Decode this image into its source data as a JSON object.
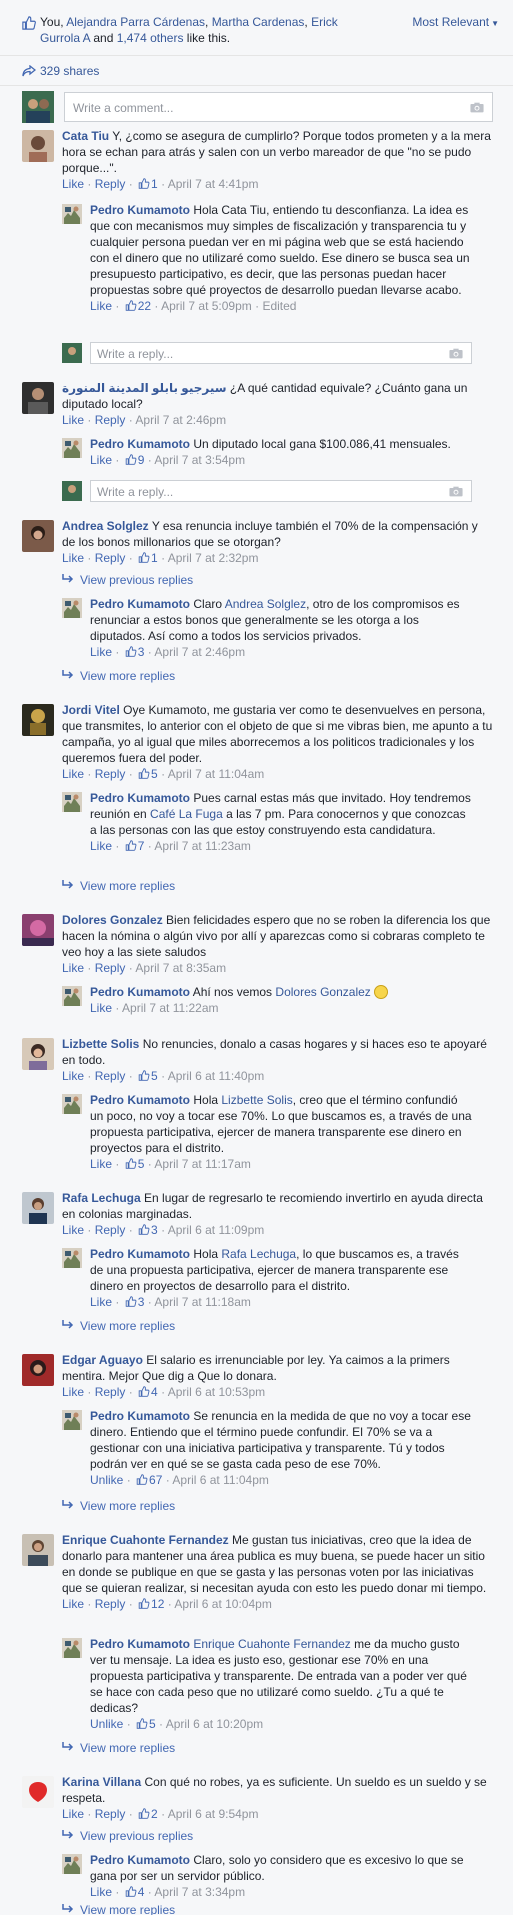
{
  "header": {
    "likes_prefix": "You, ",
    "liker1": "Alejandra Parra Cárdenas",
    "liker2": "Martha Cardenas",
    "liker3": "Erick Gurrola A",
    "and_text": " and ",
    "others": "1,474 others",
    "like_this": " like this.",
    "sort_label": "Most Relevant",
    "shares": "329 shares"
  },
  "composer": {
    "placeholder": "Write a comment..."
  },
  "reply_placeholder": "Write a reply...",
  "labels": {
    "like": "Like",
    "unlike": "Unlike",
    "reply": "Reply",
    "edited": "Edited",
    "view_previous": "View previous replies",
    "view_more": "View more replies"
  },
  "comments": [
    {
      "author": "Cata Tiu",
      "text": "Y, ¿como se asegura de cumplirlo? Porque todos prometen y a la mera hora se echan para atrás y salen con un verbo mareador de que \"no se pudo porque...\".",
      "likes": "1",
      "time": "April 7 at 4:41pm",
      "reply": {
        "author": "Pedro Kumamoto",
        "text": "Hola Cata Tiu, entiendo tu desconfianza. La idea es que con mecanismos muy simples de fiscalización y transparencia tu y cualquier persona puedan ver en mi página web que se está haciendo con el dinero que no utilizaré como sueldo. Ese dinero se busca sea un presupuesto participativo, es decir, que las personas puedan hacer propuestas sobre qué proyectos de desarrollo puedan llevarse acabo.",
        "likes": "22",
        "time": "April 7 at 5:09pm"
      }
    },
    {
      "author": "سيرجيو بابلو المدينة المنورة",
      "text": "¿A qué cantidad equivale? ¿Cuánto gana un diputado local?",
      "time": "April 7 at 2:46pm",
      "reply": {
        "author": "Pedro Kumamoto",
        "text": "Un diputado local gana $100.086,41 mensuales.",
        "likes": "9",
        "time": "April 7 at 3:54pm"
      }
    },
    {
      "author": "Andrea Solglez",
      "text": "Y esa renuncia incluye también el 70% de la compensación y de los bonos millonarios que se otorgan?",
      "likes": "1",
      "time": "April 7 at 2:32pm",
      "reply": {
        "author": "Pedro Kumamoto",
        "pre": "Claro ",
        "mention": "Andrea Solglez",
        "post": ", otro de los compromisos es renunciar a estos bonos que generalmente se les otorga a los diputados. Así como a todos los servicios privados.",
        "likes": "3",
        "time": "April 7 at 2:46pm"
      }
    },
    {
      "author": "Jordi Vitel",
      "text": "Oye Kumamoto, me gustaria ver como te desenvuelves en persona, que transmites, lo anterior con el objeto de que si me vibras bien, me apunto a tu campaña, yo al igual que miles aborrecemos a los politicos tradicionales y los queremos fuera del poder.",
      "likes": "5",
      "time": "April 7 at 11:04am",
      "reply": {
        "author": "Pedro Kumamoto",
        "pre": "Pues carnal estas más que invitado. Hoy tendremos reunión en ",
        "mention": "Café La Fuga",
        "post": " a las 7 pm. Para conocernos y que conozcas a las personas con las que estoy construyendo esta candidatura.",
        "likes": "7",
        "time": "April 7 at 11:23am"
      }
    },
    {
      "author": "Dolores Gonzalez",
      "text": "Bien felicidades espero que no se roben la diferencia los que hacen la nómina o algún vivo por allí y aparezcas como si cobraras completo te veo hoy a las siete saludos",
      "time": "April 7 at 8:35am",
      "reply": {
        "author": "Pedro Kumamoto",
        "pre": "Ahí nos vemos ",
        "mention": "Dolores Gonzalez",
        "time": "April 7 at 11:22am"
      }
    },
    {
      "author": "Lizbette Solis",
      "text": "No renuncies, donalo a casas hogares y si haces eso te apoyaré en todo.",
      "likes": "5",
      "time": "April 6 at 11:40pm",
      "reply": {
        "author": "Pedro Kumamoto",
        "pre": "Hola ",
        "mention": "Lizbette Solis",
        "post": ", creo que el término confundió un poco, no voy a tocar ese 70%. Lo que buscamos es, a través de una propuesta participativa, ejercer de manera transparente ese dinero en proyectos para el distrito.",
        "likes": "5",
        "time": "April 7 at 11:17am"
      }
    },
    {
      "author": "Rafa Lechuga",
      "text": "En lugar de regresarlo te recomiendo invertirlo en ayuda directa en colonias marginadas.",
      "likes": "3",
      "time": "April 6 at 11:09pm",
      "reply": {
        "author": "Pedro Kumamoto",
        "pre": "Hola ",
        "mention": "Rafa Lechuga",
        "post": ", lo que buscamos es, a través de una propuesta participativa, ejercer de manera transparente ese dinero en proyectos de desarrollo para el distrito.",
        "likes": "3",
        "time": "April 7 at 11:18am"
      }
    },
    {
      "author": "Edgar Aguayo",
      "text": "El salario es irrenunciable por ley. Ya caimos a la primers mentira. Mejor Que dig a Que lo donara.",
      "likes": "4",
      "time": "April 6 at 10:53pm",
      "reply": {
        "author": "Pedro Kumamoto",
        "text": "Se renuncia en la medida de que no voy a tocar ese dinero. Entiendo que el término puede confundir. El 70% se va a gestionar con una iniciativa participativa y transparente. Tú y todos podrán ver en qué se se gasta cada peso de ese 70%.",
        "likes": "67",
        "time": "April 6 at 11:04pm"
      }
    },
    {
      "author": "Enrique Cuahonte Fernandez",
      "text": "Me gustan tus iniciativas, creo que la idea de donarlo para mantener una área publica es muy buena, se puede hacer un sitio en donde se publique en que se gasta y las personas voten por las iniciativas que se quieran realizar, si necesitan ayuda con esto les puedo donar mi tiempo.",
      "likes": "12",
      "time": "April 6 at 10:04pm",
      "reply": {
        "author": "Pedro Kumamoto",
        "mention": "Enrique Cuahonte Fernandez",
        "post": " me da mucho gusto ver tu mensaje. La idea es justo eso, gestionar ese 70% en una propuesta participativa y transparente. De entrada van a poder ver qué se hace con cada peso que no utilizaré como sueldo. ¿Tu a qué te dedicas?",
        "likes": "5",
        "time": "April 6 at 10:20pm"
      }
    },
    {
      "author": "Karina Villana",
      "text": "Con qué no robes, ya es suficiente. Un sueldo es un sueldo y se respeta.",
      "likes": "2",
      "time": "April 6 at 9:54pm",
      "reply": {
        "author": "Pedro Kumamoto",
        "text": "Claro, solo yo considero que es excesivo lo que se gana por ser un servidor público.",
        "likes": "4",
        "time": "April 7 at 3:34pm"
      }
    }
  ]
}
